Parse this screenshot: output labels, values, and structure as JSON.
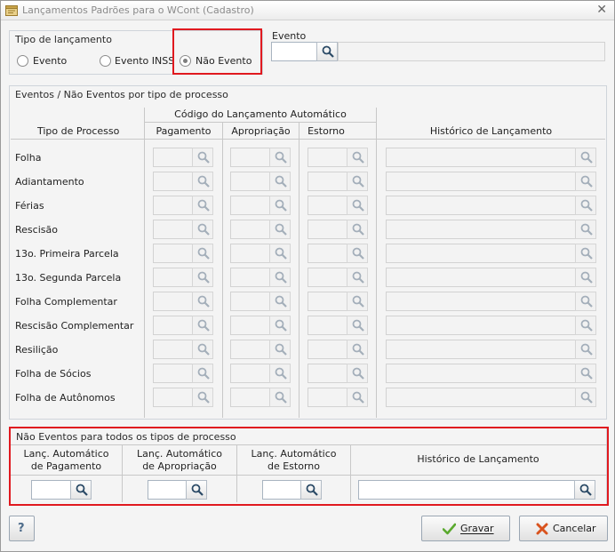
{
  "window": {
    "title": "Lançamentos Padrões para o WCont (Cadastro)",
    "close_glyph": "✕"
  },
  "tipo_lancamento": {
    "title": "Tipo de lançamento",
    "options": [
      {
        "label": "Evento",
        "checked": false
      },
      {
        "label": "Evento INSS",
        "checked": false
      },
      {
        "label": "Não Evento",
        "checked": true
      }
    ]
  },
  "evento": {
    "label": "Evento",
    "value": "",
    "description": ""
  },
  "por_tipo": {
    "title": "Eventos / Não Eventos por tipo de processo",
    "headers": {
      "tipo_processo": "Tipo de Processo",
      "codigo_group": "Código do Lançamento Automático",
      "pagamento": "Pagamento",
      "apropriacao": "Apropriação",
      "estorno": "Estorno",
      "historico": "Histórico de Lançamento"
    },
    "rows": [
      "Folha",
      "Adiantamento",
      "Férias",
      "Rescisão",
      "13o. Primeira Parcela",
      "13o. Segunda Parcela",
      "Folha Complementar",
      "Rescisão Complementar",
      "Resilição",
      "Folha de Sócios",
      "Folha de Autônomos"
    ]
  },
  "todos_tipos": {
    "title": "Não Eventos para todos os tipos de processo",
    "headers": {
      "pag_line1": "Lanç. Automático",
      "pag_line2": "de Pagamento",
      "apr_line1": "Lanç. Automático",
      "apr_line2": "de Apropriação",
      "est_line1": "Lanç. Automático",
      "est_line2": "de Estorno",
      "historico": "Histórico de Lançamento"
    },
    "values": {
      "pagamento": "",
      "apropriacao": "",
      "estorno": "",
      "historico": ""
    }
  },
  "footer": {
    "help_label": "?",
    "save_label": "Gravar",
    "cancel_label": "Cancelar"
  },
  "colors": {
    "highlight": "#e0191f",
    "save_check": "#5aa92e",
    "cancel_x": "#d9531e"
  },
  "icons": [
    "app-icon",
    "close-icon",
    "search-icon",
    "help-icon",
    "check-icon",
    "cancel-icon"
  ]
}
